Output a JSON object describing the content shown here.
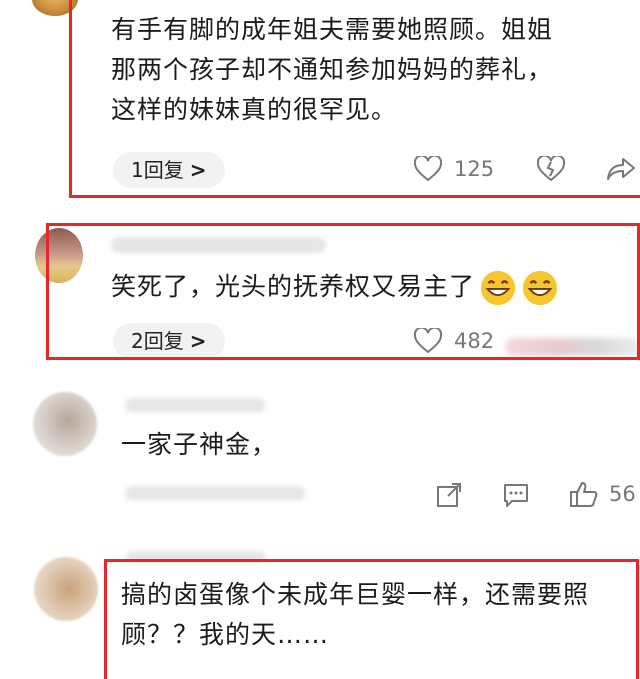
{
  "comments": [
    {
      "text": "有手有脚的成年姐夫需要她照顾。姐姐\n那两个孩子却不通知参加妈妈的葬礼，\n这样的妹妹真的很罕见。",
      "reply_label": "1回复",
      "likes": "125"
    },
    {
      "text": "笑死了，光头的抚养权又易主了",
      "reply_label": "2回复",
      "likes": "482"
    },
    {
      "text": "一家子神金，",
      "likes": "56"
    },
    {
      "text": "搞的卤蛋像个未成年巨婴一样，还需要照\n顾？？我的天……"
    }
  ],
  "colors": {
    "highlight_box": "#e8262a",
    "icon_gray": "#777777",
    "reply_bg": "#f2f2f2"
  },
  "icons": [
    "heart-icon",
    "broken-heart-icon",
    "share-icon",
    "chevron-right-icon",
    "comment-icon",
    "thumbs-up-icon",
    "grin-emoji-icon"
  ]
}
